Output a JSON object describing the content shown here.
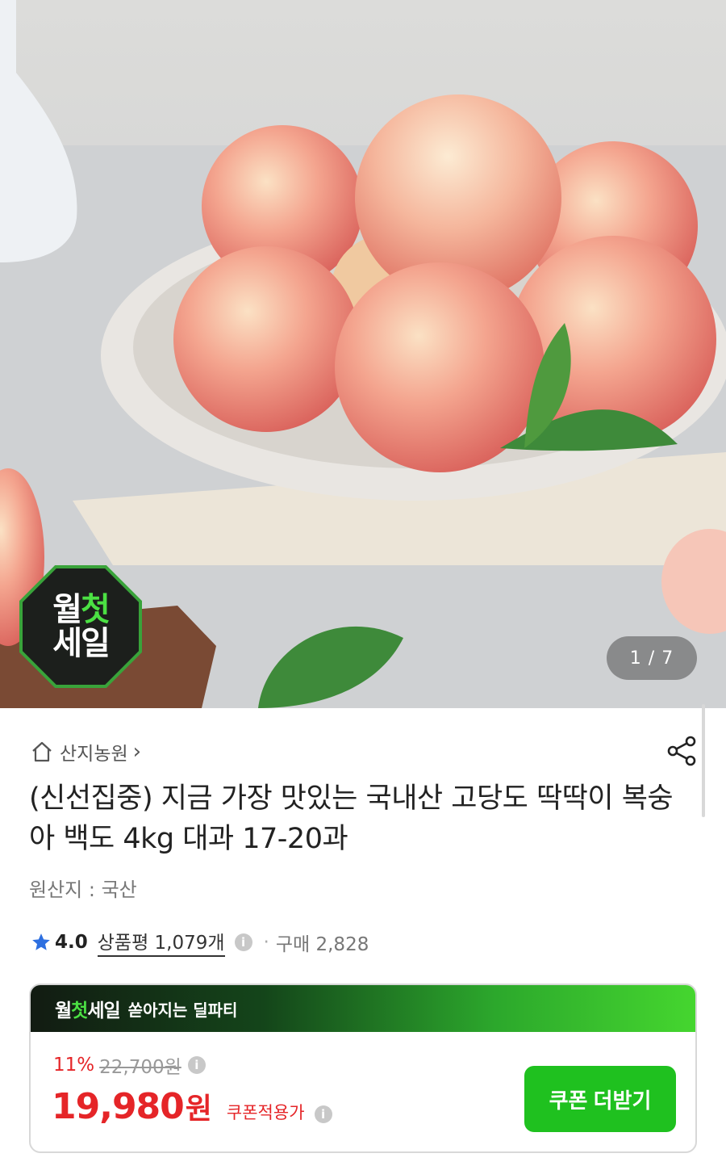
{
  "gallery": {
    "counter": "1 / 7"
  },
  "badge": {
    "line1_a": "월",
    "line1_b": "첫",
    "line2": "세일"
  },
  "seller": {
    "name": "산지농원",
    "chevron": "›"
  },
  "product": {
    "title": "(신선집중) 지금 가장 맛있는 국내산 고당도 딱딱이 복숭아 백도 4kg 대과 17-20과",
    "origin": "원산지 : 국산"
  },
  "rating": {
    "score": "4.0",
    "reviews": "상품평 1,079개",
    "separator": "·",
    "purchases": "구매 2,828"
  },
  "deal": {
    "banner_a": "월",
    "banner_b": "첫",
    "banner_c": "세일",
    "banner_sub": "쏟아지는 딜파티",
    "discount": "11%",
    "original_price": "22,700원",
    "price": "19,980",
    "price_unit": "원",
    "coupon_note": "쿠폰적용가",
    "coupon_button": "쿠폰 더받기"
  },
  "icons": {
    "home": "store-icon",
    "share": "share-icon",
    "star": "star-icon",
    "info": "info-icon"
  },
  "colors": {
    "accent_green": "#1fc11f",
    "price_red": "#e52528",
    "star_blue": "#2d6fe0"
  }
}
